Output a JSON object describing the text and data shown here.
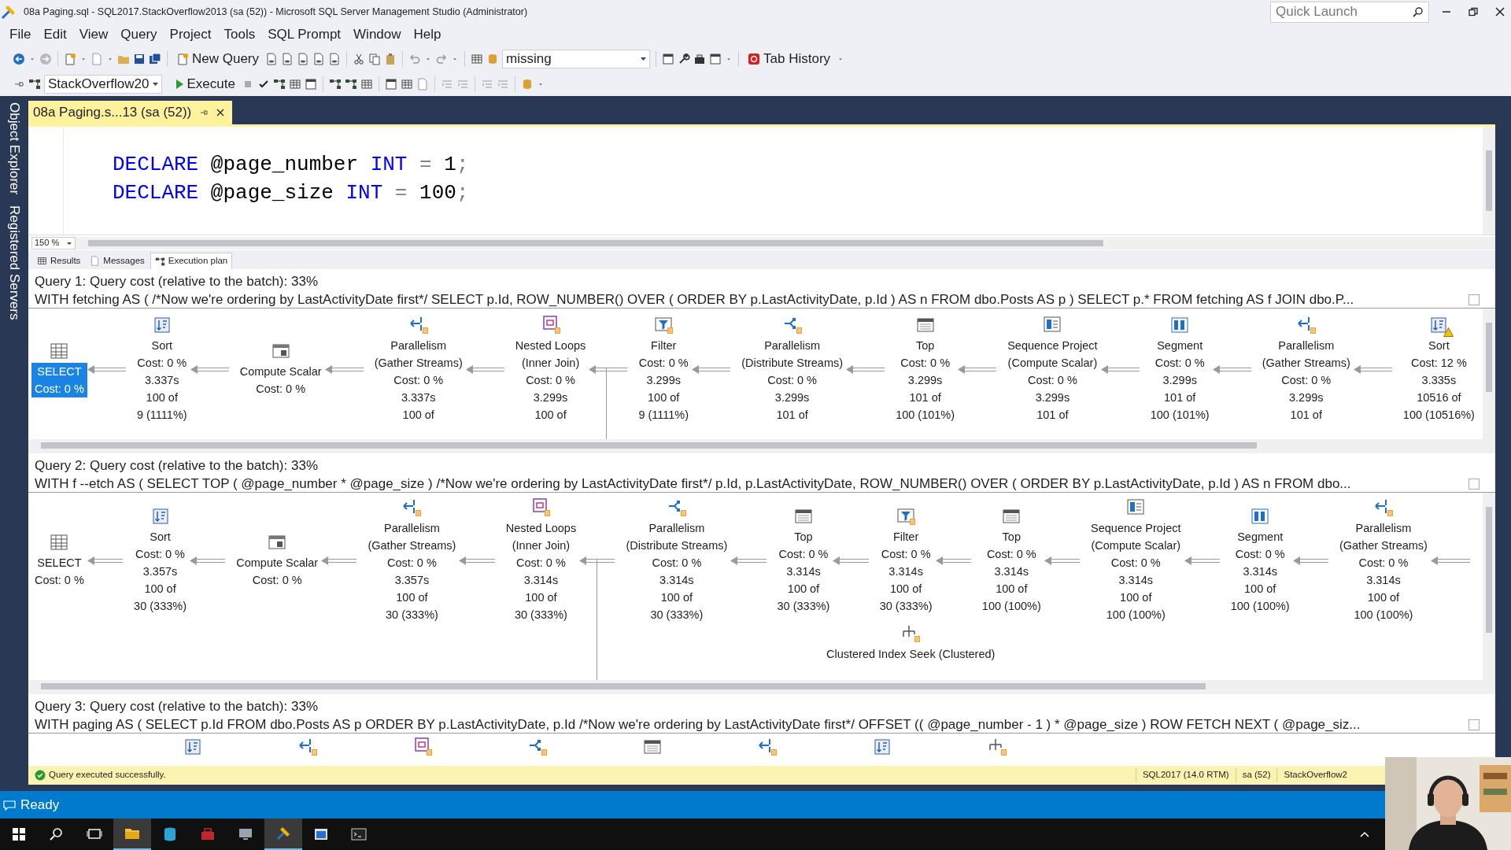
{
  "window": {
    "title": "08a Paging.sql - SQL2017.StackOverflow2013 (sa (52)) - Microsoft SQL Server Management Studio (Administrator)",
    "quick_launch": {
      "placeholder": "Quick Launch"
    }
  },
  "menu": [
    "File",
    "Edit",
    "View",
    "Query",
    "Project",
    "Tools",
    "SQL Prompt",
    "Window",
    "Help"
  ],
  "toolbar": {
    "new_query": "New Query",
    "search_combo": "missing",
    "tab_history": "Tab History",
    "database": "StackOverflow20",
    "execute": "Execute"
  },
  "side_tabs": [
    {
      "label": "Object Explorer"
    },
    {
      "label": "Registered Servers"
    }
  ],
  "document_tab": {
    "label": "08a Paging.s...13 (sa (52))",
    "selected": true
  },
  "editor": {
    "lines": [
      [
        {
          "kind": "keyword",
          "text": "DECLARE"
        },
        {
          "kind": "plain",
          "text": " @page_number "
        },
        {
          "kind": "keyword",
          "text": "INT"
        },
        {
          "kind": "operator",
          "text": " = "
        },
        {
          "kind": "plain",
          "text": "1"
        },
        {
          "kind": "operator",
          "text": ";"
        }
      ],
      [
        {
          "kind": "keyword",
          "text": "DECLARE"
        },
        {
          "kind": "plain",
          "text": " @page_size "
        },
        {
          "kind": "keyword",
          "text": "INT"
        },
        {
          "kind": "operator",
          "text": " = "
        },
        {
          "kind": "plain",
          "text": "100"
        },
        {
          "kind": "operator",
          "text": ";"
        }
      ]
    ],
    "zoom": "150 %"
  },
  "result_tabs": [
    {
      "label": "Results",
      "kind": "grid",
      "selected": false
    },
    {
      "label": "Messages",
      "kind": "messages",
      "selected": false
    },
    {
      "label": "Execution plan",
      "kind": "plan",
      "selected": true
    }
  ],
  "queries": [
    {
      "header": "Query 1: Query cost (relative to the batch): 33%",
      "sql": "WITH fetching AS ( /*Now we're ordering by LastActivityDate first*/ SELECT p.Id, ROW_NUMBER() OVER ( ORDER BY p.LastActivityDate, p.Id ) AS n FROM dbo.Posts AS p ) SELECT p.* FROM fetching AS f JOIN dbo.P...",
      "nodes": [
        {
          "kind": "select",
          "name": [
            "SELECT"
          ],
          "stats": [
            "Cost: 0 %"
          ],
          "selected": true,
          "warning": false
        },
        {
          "kind": "sort",
          "name": [
            "Sort"
          ],
          "stats": [
            "Cost: 0 %",
            "3.337s",
            "100 of",
            "9 (1111%)"
          ],
          "selected": false,
          "warning": false
        },
        {
          "kind": "compute",
          "name": [
            "Compute Scalar"
          ],
          "stats": [
            "Cost: 0 %"
          ],
          "selected": false,
          "warning": false
        },
        {
          "kind": "gather",
          "name": [
            "Parallelism",
            "(Gather Streams)"
          ],
          "stats": [
            "Cost: 0 %",
            "3.337s",
            "100 of"
          ],
          "selected": false,
          "warning": false
        },
        {
          "kind": "nested_loops",
          "name": [
            "Nested Loops",
            "(Inner Join)"
          ],
          "stats": [
            "Cost: 0 %",
            "3.299s",
            "100 of"
          ],
          "selected": false,
          "warning": false
        },
        {
          "kind": "filter",
          "name": [
            "Filter"
          ],
          "stats": [
            "Cost: 0 %",
            "3.299s",
            "100 of",
            "9 (1111%)"
          ],
          "selected": false,
          "warning": false
        },
        {
          "kind": "distribute",
          "name": [
            "Parallelism",
            "(Distribute Streams)"
          ],
          "stats": [
            "Cost: 0 %",
            "3.299s",
            "101 of"
          ],
          "selected": false,
          "warning": false
        },
        {
          "kind": "top",
          "name": [
            "Top"
          ],
          "stats": [
            "Cost: 0 %",
            "3.299s",
            "101 of",
            "100 (101%)"
          ],
          "selected": false,
          "warning": false
        },
        {
          "kind": "sequence",
          "name": [
            "Sequence Project",
            "(Compute Scalar)"
          ],
          "stats": [
            "Cost: 0 %",
            "3.299s",
            "101 of"
          ],
          "selected": false,
          "warning": false
        },
        {
          "kind": "segment",
          "name": [
            "Segment"
          ],
          "stats": [
            "Cost: 0 %",
            "3.299s",
            "101 of",
            "100 (101%)"
          ],
          "selected": false,
          "warning": false
        },
        {
          "kind": "gather",
          "name": [
            "Parallelism",
            "(Gather Streams)"
          ],
          "stats": [
            "Cost: 0 %",
            "3.299s",
            "101 of"
          ],
          "selected": false,
          "warning": false
        },
        {
          "kind": "sort",
          "name": [
            "Sort"
          ],
          "stats": [
            "Cost: 12 %",
            "3.335s",
            "10516 of",
            "100 (10516%)"
          ],
          "selected": false,
          "warning": true
        }
      ]
    },
    {
      "header": "Query 2: Query cost (relative to the batch): 33%",
      "sql": "WITH f --etch AS ( SELECT TOP ( @page_number * @page_size ) /*Now we're ordering by LastActivityDate first*/ p.Id, p.LastActivityDate, ROW_NUMBER() OVER ( ORDER BY p.LastActivityDate, p.Id ) AS n FROM dbo...",
      "continues": true,
      "nodes": [
        {
          "kind": "select",
          "name": [
            "SELECT"
          ],
          "stats": [
            "Cost: 0 %"
          ],
          "selected": false,
          "warning": false
        },
        {
          "kind": "sort",
          "name": [
            "Sort"
          ],
          "stats": [
            "Cost: 0 %",
            "3.357s",
            "100 of",
            "30 (333%)"
          ],
          "selected": false,
          "warning": false
        },
        {
          "kind": "compute",
          "name": [
            "Compute Scalar"
          ],
          "stats": [
            "Cost: 0 %"
          ],
          "selected": false,
          "warning": false
        },
        {
          "kind": "gather",
          "name": [
            "Parallelism",
            "(Gather Streams)"
          ],
          "stats": [
            "Cost: 0 %",
            "3.357s",
            "100 of",
            "30 (333%)"
          ],
          "selected": false,
          "warning": false
        },
        {
          "kind": "nested_loops",
          "name": [
            "Nested Loops",
            "(Inner Join)"
          ],
          "stats": [
            "Cost: 0 %",
            "3.314s",
            "100 of",
            "30 (333%)"
          ],
          "selected": false,
          "warning": false
        },
        {
          "kind": "distribute",
          "name": [
            "Parallelism",
            "(Distribute Streams)"
          ],
          "stats": [
            "Cost: 0 %",
            "3.314s",
            "100 of",
            "30 (333%)"
          ],
          "selected": false,
          "warning": false
        },
        {
          "kind": "top",
          "name": [
            "Top"
          ],
          "stats": [
            "Cost: 0 %",
            "3.314s",
            "100 of",
            "30 (333%)"
          ],
          "selected": false,
          "warning": false
        },
        {
          "kind": "filter",
          "name": [
            "Filter"
          ],
          "stats": [
            "Cost: 0 %",
            "3.314s",
            "100 of",
            "30 (333%)"
          ],
          "selected": false,
          "warning": false
        },
        {
          "kind": "top",
          "name": [
            "Top"
          ],
          "stats": [
            "Cost: 0 %",
            "3.314s",
            "100 of",
            "100 (100%)"
          ],
          "selected": false,
          "warning": false
        },
        {
          "kind": "sequence",
          "name": [
            "Sequence Project",
            "(Compute Scalar)"
          ],
          "stats": [
            "Cost: 0 %",
            "3.314s",
            "100 of",
            "100 (100%)"
          ],
          "selected": false,
          "warning": false
        },
        {
          "kind": "segment",
          "name": [
            "Segment"
          ],
          "stats": [
            "Cost: 0 %",
            "3.314s",
            "100 of",
            "100 (100%)"
          ],
          "selected": false,
          "warning": false
        },
        {
          "kind": "gather",
          "name": [
            "Parallelism",
            "(Gather Streams)"
          ],
          "stats": [
            "Cost: 0 %",
            "3.314s",
            "100 of",
            "100 (100%)"
          ],
          "selected": false,
          "warning": false
        }
      ],
      "lower_nodes": [
        {
          "kind": "index_seek",
          "name": [
            "Clustered Index Seek (Clustered)"
          ],
          "selected": false,
          "warning": false
        }
      ]
    },
    {
      "header": "Query 3: Query cost (relative to the batch): 33%",
      "sql": "WITH paging AS ( SELECT p.Id FROM dbo.Posts AS p ORDER BY p.LastActivityDate, p.Id /*Now we're ordering by LastActivityDate first*/ OFFSET (( @page_number - 1 ) * @page_size ) ROW FETCH NEXT ( @page_siz...",
      "nodes": [
        {
          "kind": "sort"
        },
        {
          "kind": "gather"
        },
        {
          "kind": "nested_loops"
        },
        {
          "kind": "distribute"
        },
        {
          "kind": "top"
        },
        {
          "kind": "gather"
        },
        {
          "kind": "sort"
        },
        {
          "kind": "index_seek"
        }
      ]
    }
  ],
  "status": {
    "message": "Query executed successfully.",
    "server": "SQL2017 (14.0 RTM)",
    "user": "sa (52)",
    "database": "StackOverflow2"
  },
  "app_status": "Ready"
}
